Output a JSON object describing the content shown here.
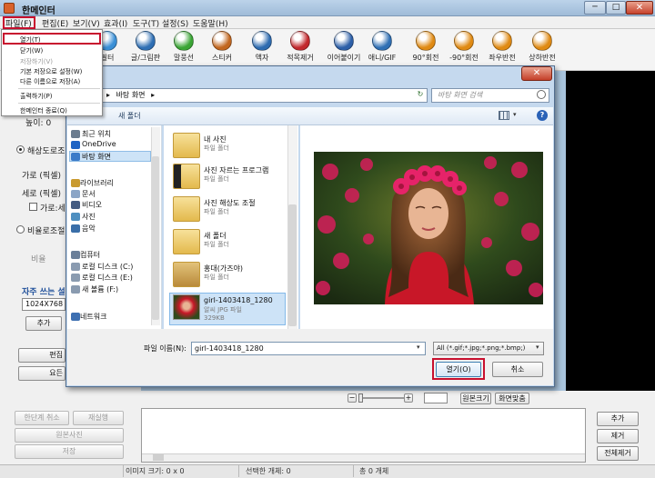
{
  "app": {
    "title": "한메인터",
    "min": "─",
    "max": "□",
    "close": "✕"
  },
  "menubar": [
    "파일(F)",
    "편집(E)",
    "보기(V)",
    "효과(I)",
    "도구(T)",
    "설정(S)",
    "도움말(H)"
  ],
  "toolbar": [
    {
      "label": "필터",
      "icon": "filter-icon",
      "color": "#3a8fd6"
    },
    {
      "label": "글/그림판",
      "icon": "text-draw-icon",
      "color": "#2f6fb4"
    },
    {
      "label": "말풍선",
      "icon": "speech-bubble-icon",
      "color": "#3aa535"
    },
    {
      "label": "스티커",
      "icon": "sticker-icon",
      "color": "#c2661e"
    },
    {
      "label": "액자",
      "icon": "frame-icon",
      "color": "#2d6bb0"
    },
    {
      "label": "적목제거",
      "icon": "red-eye-icon",
      "color": "#c2282d"
    },
    {
      "label": "이어붙이기",
      "icon": "merge-icon",
      "color": "#2c5fa8"
    },
    {
      "label": "애니/GIF",
      "icon": "gif-icon",
      "color": "#2f6fb4"
    },
    {
      "label": "90°회전",
      "icon": "rotate-cw-icon",
      "color": "#e08a13"
    },
    {
      "label": "-90°회전",
      "icon": "rotate-ccw-icon",
      "color": "#e08a13"
    },
    {
      "label": "좌우반전",
      "icon": "flip-h-icon",
      "color": "#e08a13"
    },
    {
      "label": "상하반전",
      "icon": "flip-v-icon",
      "color": "#e08a13"
    }
  ],
  "file_menu": [
    {
      "label": "열기(T)",
      "enabled": true
    },
    {
      "label": "닫기(W)",
      "enabled": true
    },
    {
      "label": "저장하기(V)",
      "enabled": false
    },
    {
      "label": "기본 저장으로 설정(W)",
      "enabled": true
    },
    {
      "label": "다른 이름으로 저장(A)",
      "enabled": true
    },
    {
      "label": "출력하기(P)",
      "enabled": true
    },
    {
      "label": "한메인터 종료(Q)",
      "enabled": true
    }
  ],
  "left_panel": {
    "height_value": "높이: 0",
    "radio_resolution": "해상도로조절",
    "width_label": "가로 (픽셀)",
    "height_label": "세로 (픽셀)",
    "keep_ratio": "가로:세",
    "radio_ratio": "비율로조절",
    "ratio_label": "비율",
    "frequent_label": "자주 쓰는 설",
    "frequent_value": "1024X768",
    "add_btn": "추가",
    "btn_partial1": "편집",
    "btn_partial2": "요든"
  },
  "zoom": {
    "minus": "−",
    "plus": "+",
    "original_btn": "원본크기",
    "fit_btn": "화면맞춤"
  },
  "bottom": {
    "undo_btn": "한단계 취소",
    "redo_btn": "재실행",
    "original_photo_btn": "원본사진",
    "save_btn": "저장",
    "add_btn": "추가",
    "remove_btn": "제거",
    "remove_all_btn": "전체제거"
  },
  "status": {
    "image_size": "이미지 크기: 0 x 0",
    "selected": "선택한 개체: 0",
    "total": "총 0 개체"
  },
  "dialog": {
    "close": "✕",
    "back": "◀",
    "forward": "▶",
    "address_prefix": "▸",
    "address": "바탕 화면",
    "address_arrow": "▸",
    "refresh": "↻",
    "search_placeholder": "바탕 화면 검색",
    "new_folder": "새 폴더",
    "view_drop": "▾",
    "help": "?",
    "nav": [
      {
        "label": "최근 위치",
        "color": "#6a7b8e"
      },
      {
        "label": "OneDrive",
        "color": "#1f64c4"
      },
      {
        "label": "바탕 화면",
        "color": "#3b7bc8"
      },
      {
        "label": "라이브러리",
        "color": "#c99a2e"
      },
      {
        "label": "문서",
        "color": "#8ba5c6"
      },
      {
        "label": "비디오",
        "color": "#445c82"
      },
      {
        "label": "사진",
        "color": "#4f8fc0"
      },
      {
        "label": "음악",
        "color": "#3a6ea8"
      },
      {
        "label": "컴퓨터",
        "color": "#6b7f99"
      },
      {
        "label": "로컬 디스크 (C:)",
        "color": "#8a9bb0"
      },
      {
        "label": "로컬 디스크 (E:)",
        "color": "#8a9bb0"
      },
      {
        "label": "새 볼륨 (F:)",
        "color": "#8a9bb0"
      },
      {
        "label": "네트워크",
        "color": "#3d6fb1"
      }
    ],
    "files": [
      {
        "name": "내 사진",
        "type": "파일 폴더"
      },
      {
        "name": "사진 자르는 프로그램",
        "type": "파일 폴더"
      },
      {
        "name": "사진 해상도 조절",
        "type": "파일 폴더"
      },
      {
        "name": "새 폴더",
        "type": "파일 폴더"
      },
      {
        "name": "홍대(가즈야)",
        "type": "파일 폴더"
      },
      {
        "name": "girl-1403418_1280",
        "type": "알씨 JPG 파일",
        "size": "329KB"
      }
    ],
    "filename_label": "파일 이름(N):",
    "filename_value": "girl-1403418_1280",
    "filetype_value": "All (*.gif;*.jpg;*.png;*.bmp;)",
    "open_btn": "열기(O)",
    "cancel_btn": "취소"
  },
  "colors": {
    "highlight_red": "#c8102e",
    "selection_blue": "#cde3f7"
  }
}
